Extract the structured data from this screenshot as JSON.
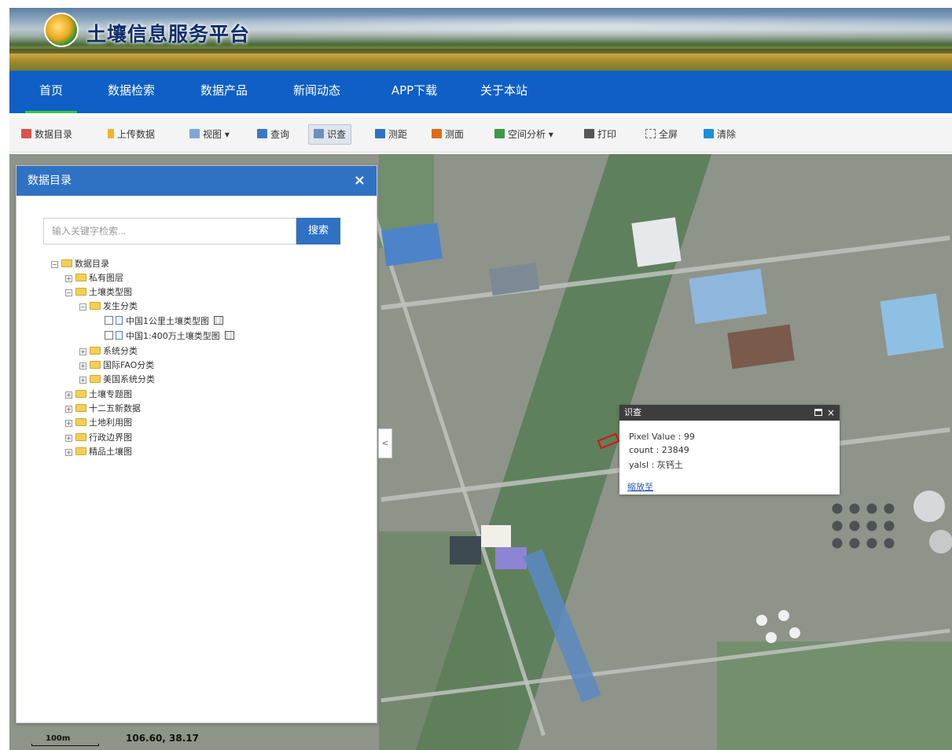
{
  "header": {
    "site_title": "土壤信息服务平台"
  },
  "nav": {
    "items": [
      {
        "label": "首页",
        "active": true
      },
      {
        "label": "数据检索"
      },
      {
        "label": "数据产品"
      },
      {
        "label": "新闻动态"
      },
      {
        "label": "APP下载"
      },
      {
        "label": "关于本站"
      }
    ]
  },
  "toolbar": {
    "tools": [
      {
        "label": "数据目录",
        "icon": "catalog-icon"
      },
      {
        "label": "上传数据",
        "icon": "upload-icon"
      },
      {
        "label": "视图 ▾",
        "icon": "view-icon"
      },
      {
        "label": "查询",
        "icon": "query-icon"
      },
      {
        "label": "识查",
        "icon": "identify-icon",
        "active": true
      },
      {
        "label": "测距",
        "icon": "measure-distance-icon"
      },
      {
        "label": "测面",
        "icon": "measure-area-icon"
      },
      {
        "label": "空间分析 ▾",
        "icon": "spatial-analysis-icon"
      },
      {
        "label": "打印",
        "icon": "print-icon"
      },
      {
        "label": "全屏",
        "icon": "fullscreen-icon"
      },
      {
        "label": "清除",
        "icon": "clear-icon"
      }
    ]
  },
  "panel": {
    "title": "数据目录",
    "close": "×",
    "search": {
      "placeholder": "输入关键字检索...",
      "button": "搜索"
    },
    "tree": [
      {
        "label": "数据目录",
        "level": 0,
        "expander": "−",
        "kind": "folder"
      },
      {
        "label": "私有图层",
        "level": 1,
        "expander": "+",
        "kind": "folder"
      },
      {
        "label": "土壤类型图",
        "level": 1,
        "expander": "−",
        "kind": "folder"
      },
      {
        "label": "发生分类",
        "level": 2,
        "expander": "−",
        "kind": "folder"
      },
      {
        "label": "中国1公里土壤类型图",
        "level": 3,
        "kind": "layer"
      },
      {
        "label": "中国1:400万土壤类型图",
        "level": 3,
        "kind": "layer"
      },
      {
        "label": "系统分类",
        "level": 2,
        "expander": "+",
        "kind": "folder"
      },
      {
        "label": "国际FAO分类",
        "level": 2,
        "expander": "+",
        "kind": "folder"
      },
      {
        "label": "美国系统分类",
        "level": 2,
        "expander": "+",
        "kind": "folder"
      },
      {
        "label": "土壤专题图",
        "level": 1,
        "expander": "+",
        "kind": "folder"
      },
      {
        "label": "十二五新数据",
        "level": 1,
        "expander": "+",
        "kind": "folder"
      },
      {
        "label": "土地利用图",
        "level": 1,
        "expander": "+",
        "kind": "folder"
      },
      {
        "label": "行政边界图",
        "level": 1,
        "expander": "+",
        "kind": "folder"
      },
      {
        "label": "精品土壤图",
        "level": 1,
        "expander": "+",
        "kind": "folder"
      }
    ],
    "collapse_glyph": "<"
  },
  "popup": {
    "title": "识查",
    "close": "×",
    "lines": [
      "Pixel Value : 99",
      "count : 23849",
      "yalsl : 灰钙土"
    ],
    "link": "缩放至"
  },
  "status": {
    "scale_label": "100m",
    "coordinates": "106.60, 38.17"
  },
  "colors": {
    "nav_bg": "#0f5fc7",
    "panel_header": "#2f72c4",
    "popup_header": "#3d3d3d",
    "highlight": "#e01010"
  }
}
